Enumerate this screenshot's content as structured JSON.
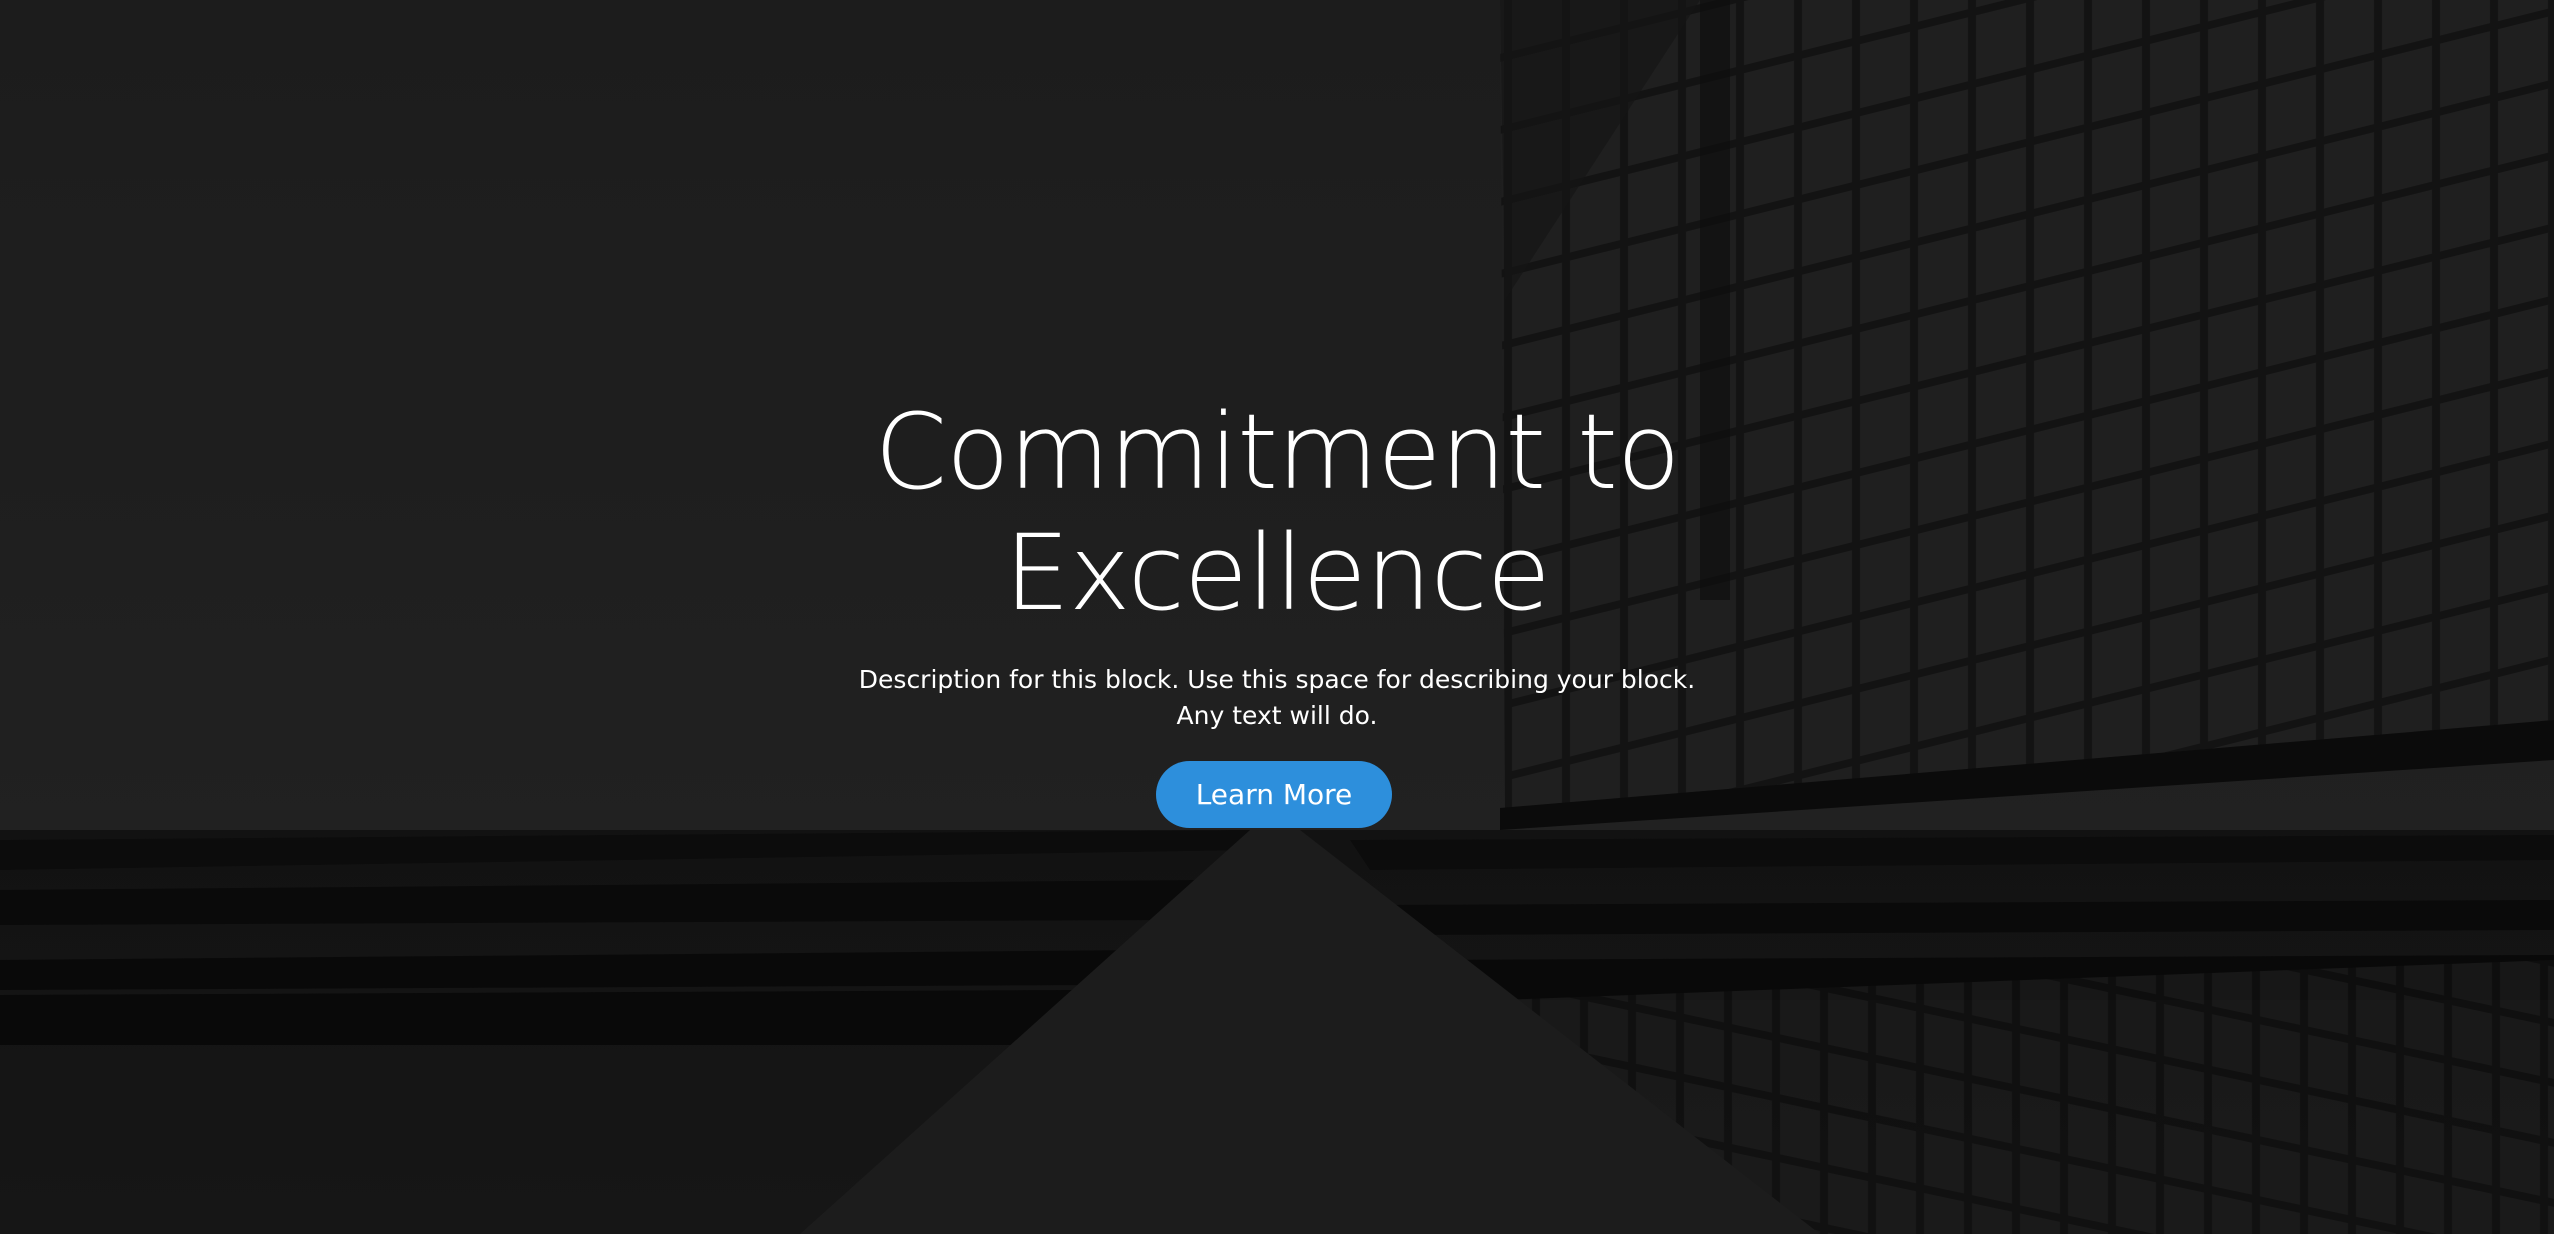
{
  "hero": {
    "title_line1": "Commitment to",
    "title_line2": "Excellence",
    "description_line1": "Description for this block. Use this space for describing your block.",
    "description_line2": "Any text will do.",
    "cta_label": "Learn More"
  },
  "colors": {
    "overlay": "#222222",
    "button": "#2d8fdc",
    "text": "#ffffff"
  },
  "background": {
    "subject": "building-facade-photo"
  }
}
